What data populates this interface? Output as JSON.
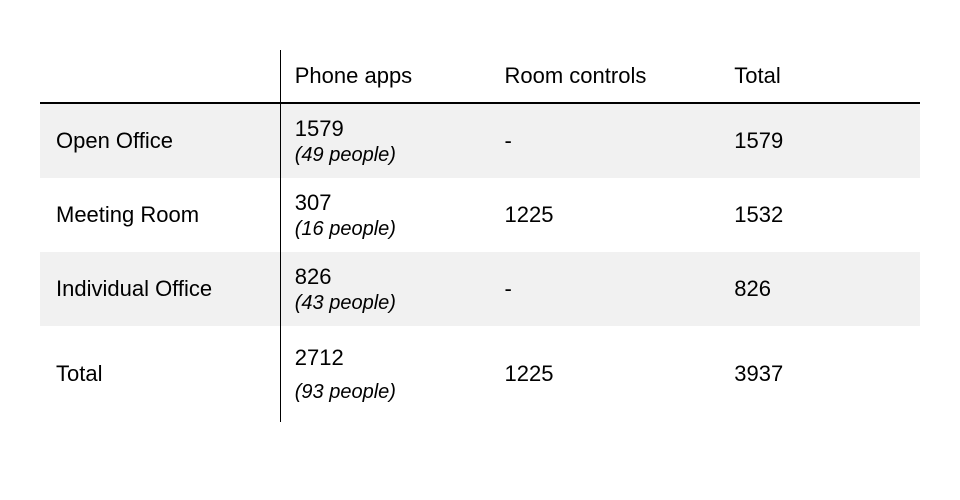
{
  "chart_data": {
    "type": "table",
    "columns": [
      "",
      "Phone apps",
      "Room controls",
      "Total"
    ],
    "rows": [
      {
        "label": "Open Office",
        "phone_apps": 1579,
        "phone_apps_people": 49,
        "room_controls": null,
        "total": 1579
      },
      {
        "label": "Meeting Room",
        "phone_apps": 307,
        "phone_apps_people": 16,
        "room_controls": 1225,
        "total": 1532
      },
      {
        "label": "Individual Office",
        "phone_apps": 826,
        "phone_apps_people": 43,
        "room_controls": null,
        "total": 826
      }
    ],
    "totals": {
      "label": "Total",
      "phone_apps": 2712,
      "phone_apps_people": 93,
      "room_controls": 1225,
      "total": 3937
    }
  },
  "headers": {
    "phone_apps": "Phone apps",
    "room_controls": "Room controls",
    "total": "Total"
  },
  "rows": [
    {
      "label": "Open Office",
      "phone_apps_value": "1579",
      "phone_apps_note": "(49 people)",
      "room_controls": "-",
      "total": "1579"
    },
    {
      "label": "Meeting Room",
      "phone_apps_value": "307",
      "phone_apps_note": "(16 people)",
      "room_controls": "1225",
      "total": "1532"
    },
    {
      "label": "Individual Office",
      "phone_apps_value": "826",
      "phone_apps_note": "(43 people)",
      "room_controls": "-",
      "total": "826"
    }
  ],
  "totals": {
    "label": "Total",
    "phone_apps_value": "2712",
    "phone_apps_note": "(93 people)",
    "room_controls": "1225",
    "total": "3937"
  }
}
